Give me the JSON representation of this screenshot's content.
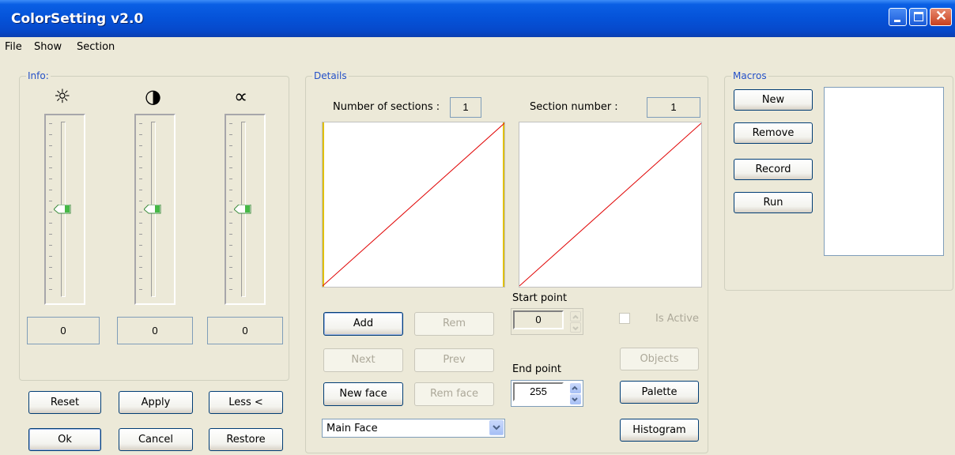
{
  "window": {
    "title": "ColorSetting v2.0"
  },
  "menu": [
    "File",
    "Show",
    "Section"
  ],
  "info": {
    "label": "Info:",
    "sliders": [
      {
        "icon": "brightness-icon",
        "glyph": "☼",
        "value": "0",
        "level": 0.5
      },
      {
        "icon": "contrast-icon",
        "glyph": "◑",
        "value": "0",
        "level": 0.5
      },
      {
        "icon": "gamma-icon",
        "glyph": "∝",
        "value": "0",
        "level": 0.5
      }
    ]
  },
  "left_buttons": {
    "reset": "Reset",
    "apply": "Apply",
    "less": "Less <",
    "ok": "Ok",
    "cancel": "Cancel",
    "restore": "Restore"
  },
  "details": {
    "label": "Details",
    "num_sections_label": "Number of sections :",
    "num_sections_value": "1",
    "section_number_label": "Section number :",
    "section_number_value": "1",
    "buttons": {
      "add": "Add",
      "rem": "Rem",
      "next": "Next",
      "prev": "Prev",
      "new_face": "New face",
      "rem_face": "Rem face",
      "objects": "Objects",
      "palette": "Palette",
      "histogram": "Histogram"
    },
    "start_point_label": "Start point",
    "start_point_value": "0",
    "end_point_label": "End point",
    "end_point_value": "255",
    "is_active_label": "Is Active",
    "face_select": "Main Face"
  },
  "macros": {
    "label": "Macros",
    "buttons": {
      "new": "New",
      "remove": "Remove",
      "record": "Record",
      "run": "Run"
    }
  },
  "colors": {
    "titlebar": "#0552d8",
    "curve": "#e00000",
    "section_marker": "#e0c000",
    "group_label": "#2450c8"
  }
}
